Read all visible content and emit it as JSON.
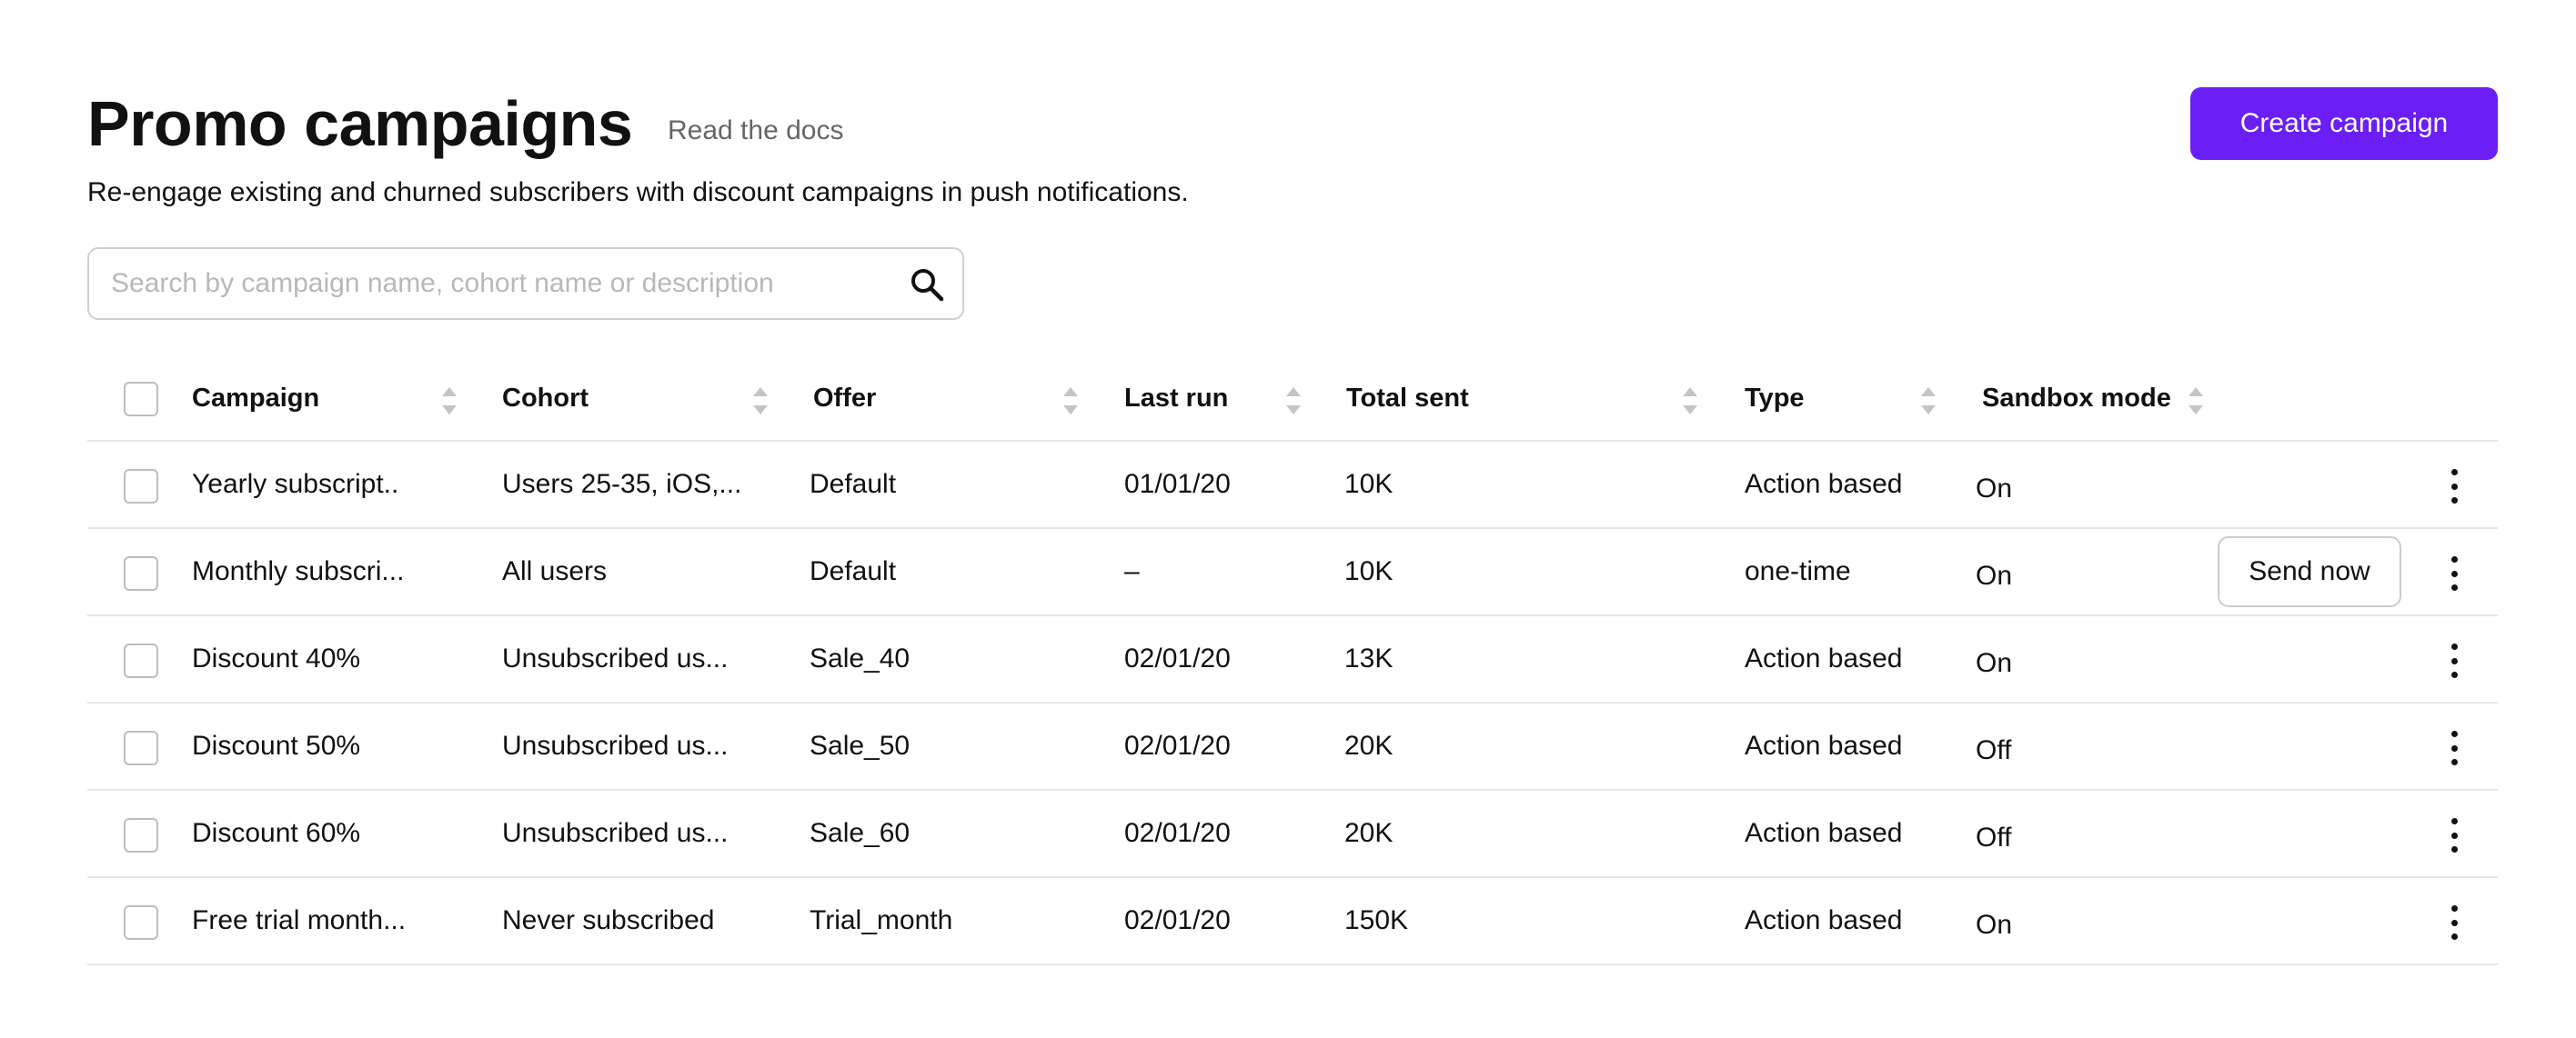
{
  "header": {
    "title": "Promo campaigns",
    "docs_link": "Read the docs",
    "subtitle": "Re-engage existing and churned subscribers with discount campaigns in push notifications.",
    "create_button": "Create campaign"
  },
  "search": {
    "placeholder": "Search by campaign name, cohort name or description",
    "icon": "search-icon"
  },
  "colors": {
    "accent": "#6b1ef5",
    "text": "#111111",
    "muted": "#666666",
    "border": "#e6e6e6"
  },
  "table": {
    "columns": [
      "Campaign",
      "Cohort",
      "Offer",
      "Last run",
      "Total sent",
      "Type",
      "Sandbox mode"
    ],
    "rows": [
      {
        "campaign": "Yearly subscript..",
        "cohort": "Users 25-35, iOS,...",
        "offer": "Default",
        "last_run": "01/01/20",
        "total_sent": "10K",
        "type": "Action based",
        "sandbox": "On"
      },
      {
        "campaign": "Monthly subscri...",
        "cohort": "All users",
        "offer": "Default",
        "last_run": "–",
        "total_sent": "10K",
        "type": "one-time",
        "sandbox": "On",
        "action": "Send now"
      },
      {
        "campaign": "Discount 40%",
        "cohort": "Unsubscribed us...",
        "offer": "Sale_40",
        "last_run": "02/01/20",
        "total_sent": "13K",
        "type": "Action based",
        "sandbox": "On"
      },
      {
        "campaign": "Discount 50%",
        "cohort": "Unsubscribed us...",
        "offer": "Sale_50",
        "last_run": "02/01/20",
        "total_sent": "20K",
        "type": "Action based",
        "sandbox": "Off"
      },
      {
        "campaign": "Discount 60%",
        "cohort": "Unsubscribed us...",
        "offer": "Sale_60",
        "last_run": "02/01/20",
        "total_sent": "20K",
        "type": "Action based",
        "sandbox": "Off"
      },
      {
        "campaign": "Free trial month...",
        "cohort": "Never subscribed",
        "offer": "Trial_month",
        "last_run": "02/01/20",
        "total_sent": "150K",
        "type": "Action based",
        "sandbox": "On"
      }
    ],
    "row_menu_icon": "more-vertical-icon",
    "sort_icon": "sort-icon"
  }
}
